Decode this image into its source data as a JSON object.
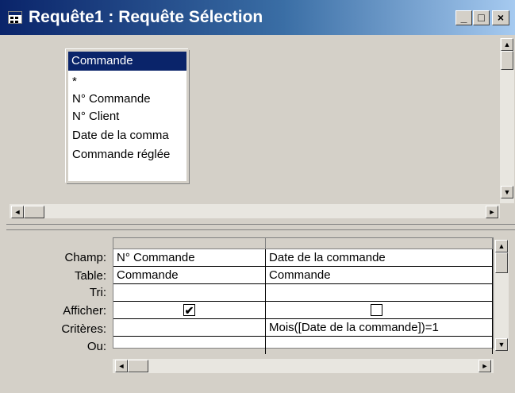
{
  "window": {
    "title": "Requête1 : Requête Sélection",
    "minimize_glyph": "_",
    "maximize_glyph": "□",
    "close_glyph": "×"
  },
  "table_box": {
    "title": "Commande",
    "fields": [
      "*",
      "N° Commande",
      "N° Client",
      "Date de la comma",
      "Commande réglée"
    ]
  },
  "grid": {
    "row_labels": [
      "Champ:",
      "Table:",
      "Tri:",
      "Afficher:",
      "Critères:",
      "Ou:"
    ],
    "columns": [
      {
        "champ": "N° Commande",
        "table": "Commande",
        "tri": "",
        "afficher": true,
        "afficher_glyph": "✔",
        "criteres": "",
        "ou": ""
      },
      {
        "champ": "Date de la commande",
        "table": "Commande",
        "tri": "",
        "afficher": false,
        "afficher_glyph": "",
        "criteres": "Mois([Date de la commande])=1",
        "ou": ""
      }
    ]
  },
  "scroll": {
    "up": "▲",
    "down": "▼",
    "left": "◄",
    "right": "►"
  },
  "colors": {
    "titlebar_start": "#0a246a",
    "titlebar_end": "#a6caf0",
    "face": "#d4d0c8",
    "selection": "#0a246a"
  }
}
